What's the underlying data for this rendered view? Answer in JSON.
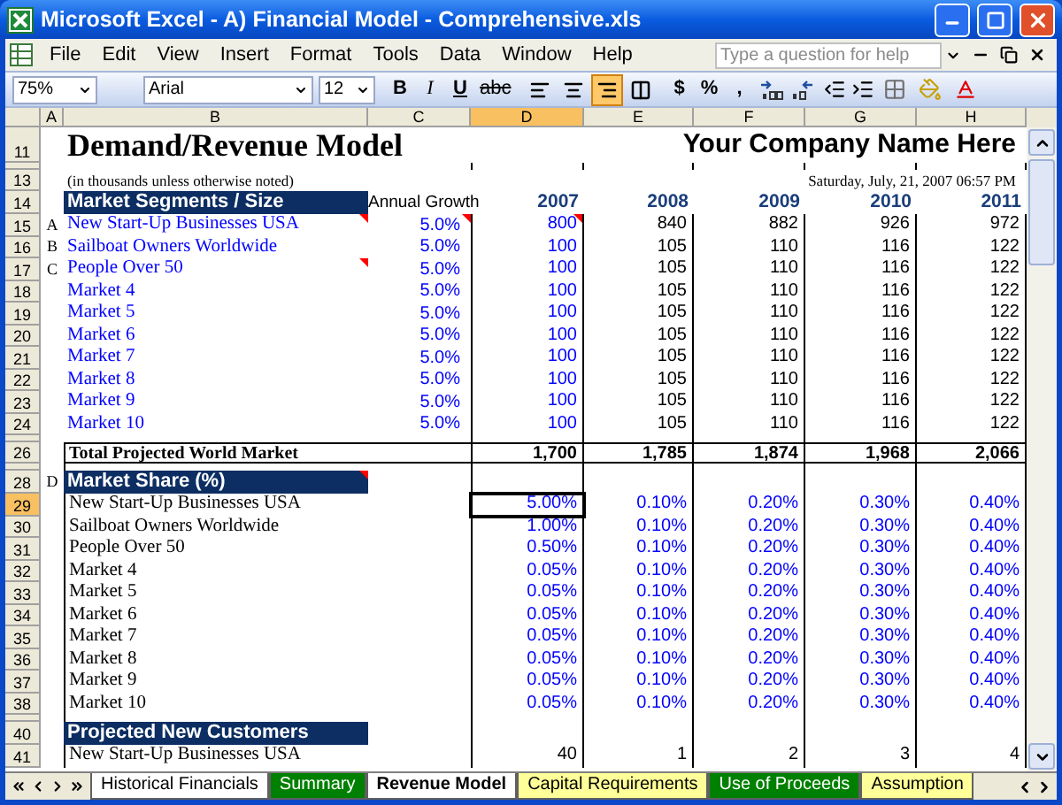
{
  "window": {
    "title": "Microsoft Excel - A) Financial Model - Comprehensive.xls"
  },
  "menu": [
    "File",
    "Edit",
    "View",
    "Insert",
    "Format",
    "Tools",
    "Data",
    "Window",
    "Help"
  ],
  "help_box": {
    "placeholder": "Type a question for help"
  },
  "toolbar": {
    "zoom": "75%",
    "font": "Arial",
    "size": "12",
    "styles": [
      "B",
      "I",
      "U",
      "abc"
    ],
    "align": [
      {
        "selected": false
      },
      {
        "selected": false
      },
      {
        "selected": true
      },
      {
        "selected": false
      }
    ],
    "number_formats": [
      "$",
      "%",
      ","
    ]
  },
  "columns": [
    {
      "label": "A",
      "selected": false
    },
    {
      "label": "B",
      "selected": false
    },
    {
      "label": "C",
      "selected": false
    },
    {
      "label": "D",
      "selected": true
    },
    {
      "label": "E",
      "selected": false
    },
    {
      "label": "F",
      "selected": false
    },
    {
      "label": "G",
      "selected": false
    },
    {
      "label": "H",
      "selected": false
    }
  ],
  "rows": [
    {
      "kind": "title",
      "number": "11",
      "selected": false,
      "title": "Demand/Revenue Model",
      "company": "Your Company Name Here"
    },
    {
      "kind": "gap"
    },
    {
      "kind": "note",
      "number": "13",
      "selected": false,
      "note": "(in thousands unless otherwise noted)",
      "date": "Saturday, July, 21, 2007 06:57 PM"
    },
    {
      "kind": "section",
      "number": "14",
      "selected": false,
      "label": "Market Segments / Size",
      "comment": false,
      "growth_label": "Annual Growth",
      "years": [
        "2007",
        "2008",
        "2009",
        "2010",
        "2011"
      ]
    },
    {
      "kind": "data",
      "number": "15",
      "selected": false,
      "marker": "A",
      "label": {
        "text": "New Start-Up Businesses USA",
        "input": true,
        "comment": true
      },
      "growth": {
        "text": "5.0%",
        "input": true,
        "comment": true
      },
      "values": [
        {
          "text": "800",
          "input": true,
          "comment": true
        },
        {
          "text": "840",
          "input": false,
          "comment": false
        },
        {
          "text": "882",
          "input": false,
          "comment": false
        },
        {
          "text": "926",
          "input": false,
          "comment": false
        },
        {
          "text": "972",
          "input": false,
          "comment": false
        }
      ]
    },
    {
      "kind": "data",
      "number": "16",
      "selected": false,
      "marker": "B",
      "label": {
        "text": "Sailboat Owners Worldwide",
        "input": true,
        "comment": false
      },
      "growth": {
        "text": "5.0%",
        "input": true,
        "comment": false
      },
      "values": [
        {
          "text": "100",
          "input": true,
          "comment": false
        },
        {
          "text": "105",
          "input": false,
          "comment": false
        },
        {
          "text": "110",
          "input": false,
          "comment": false
        },
        {
          "text": "116",
          "input": false,
          "comment": false
        },
        {
          "text": "122",
          "input": false,
          "comment": false
        }
      ]
    },
    {
      "kind": "data",
      "number": "17",
      "selected": false,
      "marker": "C",
      "label": {
        "text": "People Over 50",
        "input": true,
        "comment": true
      },
      "growth": {
        "text": "5.0%",
        "input": true,
        "comment": false
      },
      "values": [
        {
          "text": "100",
          "input": true,
          "comment": false
        },
        {
          "text": "105",
          "input": false,
          "comment": false
        },
        {
          "text": "110",
          "input": false,
          "comment": false
        },
        {
          "text": "116",
          "input": false,
          "comment": false
        },
        {
          "text": "122",
          "input": false,
          "comment": false
        }
      ]
    },
    {
      "kind": "data",
      "number": "18",
      "selected": false,
      "label": {
        "text": "Market 4",
        "input": true,
        "comment": false
      },
      "growth": {
        "text": "5.0%",
        "input": true,
        "comment": false
      },
      "values": [
        {
          "text": "100",
          "input": true,
          "comment": false
        },
        {
          "text": "105",
          "input": false,
          "comment": false
        },
        {
          "text": "110",
          "input": false,
          "comment": false
        },
        {
          "text": "116",
          "input": false,
          "comment": false
        },
        {
          "text": "122",
          "input": false,
          "comment": false
        }
      ]
    },
    {
      "kind": "data",
      "number": "19",
      "selected": false,
      "label": {
        "text": "Market 5",
        "input": true,
        "comment": false
      },
      "growth": {
        "text": "5.0%",
        "input": true,
        "comment": false
      },
      "values": [
        {
          "text": "100",
          "input": true,
          "comment": false
        },
        {
          "text": "105",
          "input": false,
          "comment": false
        },
        {
          "text": "110",
          "input": false,
          "comment": false
        },
        {
          "text": "116",
          "input": false,
          "comment": false
        },
        {
          "text": "122",
          "input": false,
          "comment": false
        }
      ]
    },
    {
      "kind": "data",
      "number": "20",
      "selected": false,
      "label": {
        "text": "Market 6",
        "input": true,
        "comment": false
      },
      "growth": {
        "text": "5.0%",
        "input": true,
        "comment": false
      },
      "values": [
        {
          "text": "100",
          "input": true,
          "comment": false
        },
        {
          "text": "105",
          "input": false,
          "comment": false
        },
        {
          "text": "110",
          "input": false,
          "comment": false
        },
        {
          "text": "116",
          "input": false,
          "comment": false
        },
        {
          "text": "122",
          "input": false,
          "comment": false
        }
      ]
    },
    {
      "kind": "data",
      "number": "21",
      "selected": false,
      "label": {
        "text": "Market 7",
        "input": true,
        "comment": false
      },
      "growth": {
        "text": "5.0%",
        "input": true,
        "comment": false
      },
      "values": [
        {
          "text": "100",
          "input": true,
          "comment": false
        },
        {
          "text": "105",
          "input": false,
          "comment": false
        },
        {
          "text": "110",
          "input": false,
          "comment": false
        },
        {
          "text": "116",
          "input": false,
          "comment": false
        },
        {
          "text": "122",
          "input": false,
          "comment": false
        }
      ]
    },
    {
      "kind": "data",
      "number": "22",
      "selected": false,
      "label": {
        "text": "Market 8",
        "input": true,
        "comment": false
      },
      "growth": {
        "text": "5.0%",
        "input": true,
        "comment": false
      },
      "values": [
        {
          "text": "100",
          "input": true,
          "comment": false
        },
        {
          "text": "105",
          "input": false,
          "comment": false
        },
        {
          "text": "110",
          "input": false,
          "comment": false
        },
        {
          "text": "116",
          "input": false,
          "comment": false
        },
        {
          "text": "122",
          "input": false,
          "comment": false
        }
      ]
    },
    {
      "kind": "data",
      "number": "23",
      "selected": false,
      "label": {
        "text": "Market 9",
        "input": true,
        "comment": false
      },
      "growth": {
        "text": "5.0%",
        "input": true,
        "comment": false
      },
      "values": [
        {
          "text": "100",
          "input": true,
          "comment": false
        },
        {
          "text": "105",
          "input": false,
          "comment": false
        },
        {
          "text": "110",
          "input": false,
          "comment": false
        },
        {
          "text": "116",
          "input": false,
          "comment": false
        },
        {
          "text": "122",
          "input": false,
          "comment": false
        }
      ]
    },
    {
      "kind": "data",
      "number": "24",
      "selected": false,
      "label": {
        "text": "Market 10",
        "input": true,
        "comment": false
      },
      "growth": {
        "text": "5.0%",
        "input": true,
        "comment": false
      },
      "values": [
        {
          "text": "100",
          "input": true,
          "comment": false
        },
        {
          "text": "105",
          "input": false,
          "comment": false
        },
        {
          "text": "110",
          "input": false,
          "comment": false
        },
        {
          "text": "116",
          "input": false,
          "comment": false
        },
        {
          "text": "122",
          "input": false,
          "comment": false
        }
      ]
    },
    {
      "kind": "gap"
    },
    {
      "kind": "total",
      "number": "26",
      "selected": false,
      "label": "Total Projected World Market",
      "values": [
        "1,700",
        "1,785",
        "1,874",
        "1,968",
        "2,066"
      ]
    },
    {
      "kind": "gap"
    },
    {
      "kind": "section",
      "number": "28",
      "selected": false,
      "marker": "D",
      "label": "Market Share (%)",
      "comment": true
    },
    {
      "kind": "data",
      "number": "29",
      "selected": true,
      "label": {
        "text": "New Start-Up Businesses USA",
        "input": false,
        "comment": false
      },
      "values": [
        {
          "text": "5.00%",
          "input": true,
          "comment": false
        },
        {
          "text": "0.10%",
          "input": true,
          "comment": false
        },
        {
          "text": "0.20%",
          "input": true,
          "comment": false
        },
        {
          "text": "0.30%",
          "input": true,
          "comment": false
        },
        {
          "text": "0.40%",
          "input": true,
          "comment": false
        }
      ]
    },
    {
      "kind": "data",
      "number": "30",
      "selected": false,
      "label": {
        "text": "Sailboat Owners Worldwide",
        "input": false,
        "comment": false
      },
      "values": [
        {
          "text": "1.00%",
          "input": true,
          "comment": false
        },
        {
          "text": "0.10%",
          "input": true,
          "comment": false
        },
        {
          "text": "0.20%",
          "input": true,
          "comment": false
        },
        {
          "text": "0.30%",
          "input": true,
          "comment": false
        },
        {
          "text": "0.40%",
          "input": true,
          "comment": false
        }
      ]
    },
    {
      "kind": "data",
      "number": "31",
      "selected": false,
      "label": {
        "text": "People Over 50",
        "input": false,
        "comment": false
      },
      "values": [
        {
          "text": "0.50%",
          "input": true,
          "comment": false
        },
        {
          "text": "0.10%",
          "input": true,
          "comment": false
        },
        {
          "text": "0.20%",
          "input": true,
          "comment": false
        },
        {
          "text": "0.30%",
          "input": true,
          "comment": false
        },
        {
          "text": "0.40%",
          "input": true,
          "comment": false
        }
      ]
    },
    {
      "kind": "data",
      "number": "32",
      "selected": false,
      "label": {
        "text": "Market 4",
        "input": false,
        "comment": false
      },
      "values": [
        {
          "text": "0.05%",
          "input": true,
          "comment": false
        },
        {
          "text": "0.10%",
          "input": true,
          "comment": false
        },
        {
          "text": "0.20%",
          "input": true,
          "comment": false
        },
        {
          "text": "0.30%",
          "input": true,
          "comment": false
        },
        {
          "text": "0.40%",
          "input": true,
          "comment": false
        }
      ]
    },
    {
      "kind": "data",
      "number": "33",
      "selected": false,
      "label": {
        "text": "Market 5",
        "input": false,
        "comment": false
      },
      "values": [
        {
          "text": "0.05%",
          "input": true,
          "comment": false
        },
        {
          "text": "0.10%",
          "input": true,
          "comment": false
        },
        {
          "text": "0.20%",
          "input": true,
          "comment": false
        },
        {
          "text": "0.30%",
          "input": true,
          "comment": false
        },
        {
          "text": "0.40%",
          "input": true,
          "comment": false
        }
      ]
    },
    {
      "kind": "data",
      "number": "34",
      "selected": false,
      "label": {
        "text": "Market 6",
        "input": false,
        "comment": false
      },
      "values": [
        {
          "text": "0.05%",
          "input": true,
          "comment": false
        },
        {
          "text": "0.10%",
          "input": true,
          "comment": false
        },
        {
          "text": "0.20%",
          "input": true,
          "comment": false
        },
        {
          "text": "0.30%",
          "input": true,
          "comment": false
        },
        {
          "text": "0.40%",
          "input": true,
          "comment": false
        }
      ]
    },
    {
      "kind": "data",
      "number": "35",
      "selected": false,
      "label": {
        "text": "Market 7",
        "input": false,
        "comment": false
      },
      "values": [
        {
          "text": "0.05%",
          "input": true,
          "comment": false
        },
        {
          "text": "0.10%",
          "input": true,
          "comment": false
        },
        {
          "text": "0.20%",
          "input": true,
          "comment": false
        },
        {
          "text": "0.30%",
          "input": true,
          "comment": false
        },
        {
          "text": "0.40%",
          "input": true,
          "comment": false
        }
      ]
    },
    {
      "kind": "data",
      "number": "36",
      "selected": false,
      "label": {
        "text": "Market 8",
        "input": false,
        "comment": false
      },
      "values": [
        {
          "text": "0.05%",
          "input": true,
          "comment": false
        },
        {
          "text": "0.10%",
          "input": true,
          "comment": false
        },
        {
          "text": "0.20%",
          "input": true,
          "comment": false
        },
        {
          "text": "0.30%",
          "input": true,
          "comment": false
        },
        {
          "text": "0.40%",
          "input": true,
          "comment": false
        }
      ]
    },
    {
      "kind": "data",
      "number": "37",
      "selected": false,
      "label": {
        "text": "Market 9",
        "input": false,
        "comment": false
      },
      "values": [
        {
          "text": "0.05%",
          "input": true,
          "comment": false
        },
        {
          "text": "0.10%",
          "input": true,
          "comment": false
        },
        {
          "text": "0.20%",
          "input": true,
          "comment": false
        },
        {
          "text": "0.30%",
          "input": true,
          "comment": false
        },
        {
          "text": "0.40%",
          "input": true,
          "comment": false
        }
      ]
    },
    {
      "kind": "data",
      "number": "38",
      "selected": false,
      "label": {
        "text": "Market 10",
        "input": false,
        "comment": false
      },
      "values": [
        {
          "text": "0.05%",
          "input": true,
          "comment": false
        },
        {
          "text": "0.10%",
          "input": true,
          "comment": false
        },
        {
          "text": "0.20%",
          "input": true,
          "comment": false
        },
        {
          "text": "0.30%",
          "input": true,
          "comment": false
        },
        {
          "text": "0.40%",
          "input": true,
          "comment": false
        }
      ]
    },
    {
      "kind": "gap"
    },
    {
      "kind": "section",
      "number": "40",
      "selected": false,
      "label": "Projected New Customers",
      "comment": false
    },
    {
      "kind": "data",
      "number": "41",
      "selected": false,
      "label": {
        "text": "New Start-Up Businesses USA",
        "input": false,
        "comment": false
      },
      "values": [
        {
          "text": "40",
          "input": false,
          "comment": false
        },
        {
          "text": "1",
          "input": false,
          "comment": false
        },
        {
          "text": "2",
          "input": false,
          "comment": false
        },
        {
          "text": "3",
          "input": false,
          "comment": false
        },
        {
          "text": "4",
          "input": false,
          "comment": false
        }
      ]
    }
  ],
  "sheet_tabs": [
    {
      "label": "Historical Financials",
      "selected": false,
      "color": "#ffffff"
    },
    {
      "label": "Summary",
      "selected": false,
      "color": "#008000"
    },
    {
      "label": "Revenue Model",
      "selected": true,
      "color": "#ffffff"
    },
    {
      "label": "Capital Requirements",
      "selected": false,
      "color": "#ffff99"
    },
    {
      "label": "Use of Proceeds",
      "selected": false,
      "color": "#008000"
    },
    {
      "label": "Assumption",
      "selected": false,
      "color": "#ffff99"
    }
  ]
}
